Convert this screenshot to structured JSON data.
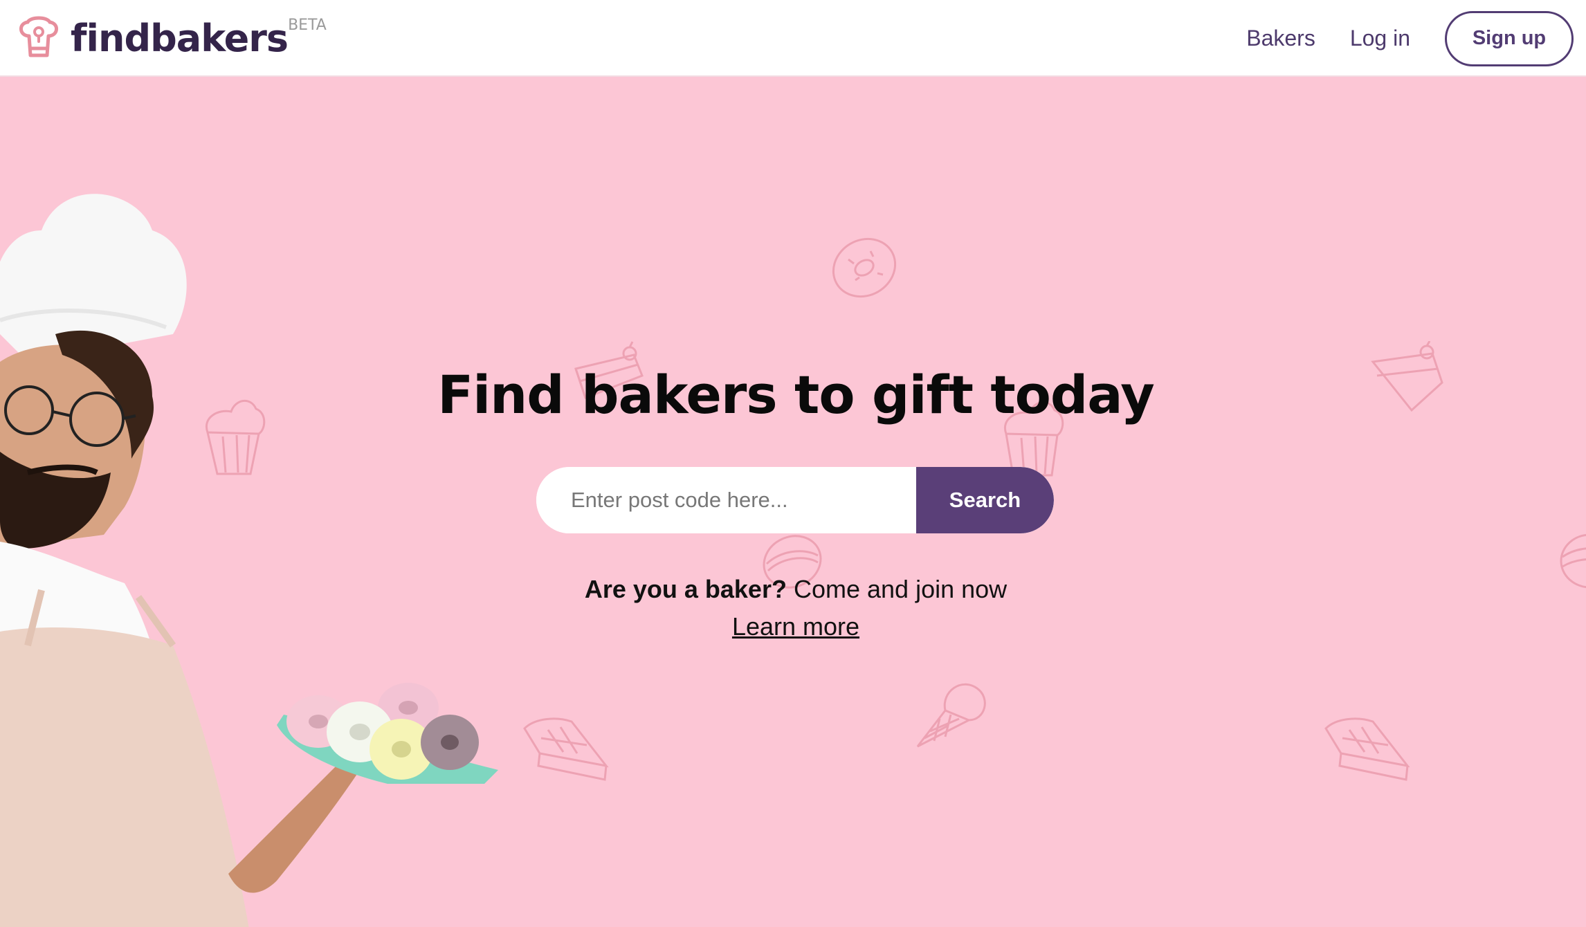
{
  "header": {
    "logo_text": "findbakers",
    "logo_badge": "BETA",
    "nav": {
      "bakers": "Bakers",
      "login": "Log in",
      "signup": "Sign up"
    }
  },
  "hero": {
    "title": "Find bakers to gift today",
    "search": {
      "placeholder": "Enter post code here...",
      "button": "Search"
    },
    "baker_prompt_bold": "Are you a baker?",
    "baker_prompt_rest": " Come and join now",
    "learn_more": "Learn more"
  },
  "colors": {
    "background": "#fcc6d5",
    "brand_dark": "#34244a",
    "accent_purple": "#5a3f78",
    "logo_pink": "#e78e9c"
  }
}
